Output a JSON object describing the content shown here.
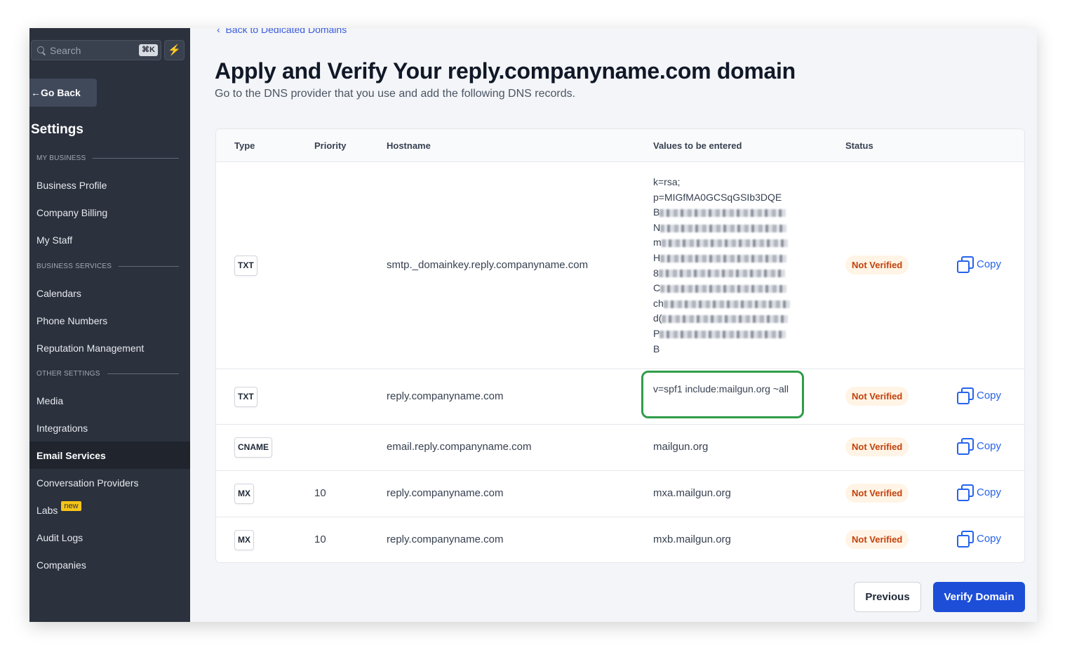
{
  "sidebar": {
    "search": {
      "placeholder": "Search",
      "shortcut": "⌘K"
    },
    "go_back": "Go Back",
    "title": "Settings",
    "sections": [
      {
        "label": "MY BUSINESS",
        "items": [
          "Business Profile",
          "Company Billing",
          "My Staff"
        ]
      },
      {
        "label": "BUSINESS SERVICES",
        "items": [
          "Calendars",
          "Phone Numbers",
          "Reputation Management"
        ]
      },
      {
        "label": "OTHER SETTINGS",
        "items": [
          "Media",
          "Integrations",
          "Email Services",
          "Conversation Providers",
          "Labs",
          "Audit Logs",
          "Companies"
        ]
      }
    ],
    "active_item": "Email Services",
    "labs_badge": "new"
  },
  "main": {
    "back_link": "Back to Dedicated Domains",
    "title": "Apply and Verify Your reply.companyname.com domain",
    "subtitle": "Go to the DNS provider that you use and add the following DNS records.",
    "table": {
      "headers": [
        "Type",
        "Priority",
        "Hostname",
        "Values to be entered",
        "Status"
      ],
      "rows": [
        {
          "type": "TXT",
          "priority": "",
          "hostname": "smtp._domainkey.reply.companyname.com",
          "value_lines": [
            "k=rsa;",
            "p=MIGfMA0GCSqGSIb3DQE",
            "B",
            "N",
            "m",
            "H",
            "8",
            "C",
            "ch",
            "d(",
            "P",
            "B"
          ],
          "status": "Not Verified",
          "copy": "Copy"
        },
        {
          "type": "TXT",
          "priority": "",
          "hostname": "reply.companyname.com",
          "value": "v=spf1 include:mailgun.org ~all",
          "status": "Not Verified",
          "copy": "Copy"
        },
        {
          "type": "CNAME",
          "priority": "",
          "hostname": "email.reply.companyname.com",
          "value": "mailgun.org",
          "status": "Not Verified",
          "copy": "Copy"
        },
        {
          "type": "MX",
          "priority": "10",
          "hostname": "reply.companyname.com",
          "value": "mxa.mailgun.org",
          "status": "Not Verified",
          "copy": "Copy"
        },
        {
          "type": "MX",
          "priority": "10",
          "hostname": "reply.companyname.com",
          "value": "mxb.mailgun.org",
          "status": "Not Verified",
          "copy": "Copy"
        }
      ]
    },
    "buttons": {
      "previous": "Previous",
      "verify": "Verify Domain"
    }
  },
  "colors": {
    "sidebar_bg": "#2b313d",
    "accent": "#1d4ed8",
    "status_warning": "#c2410c",
    "highlight": "#2f9d4a"
  }
}
